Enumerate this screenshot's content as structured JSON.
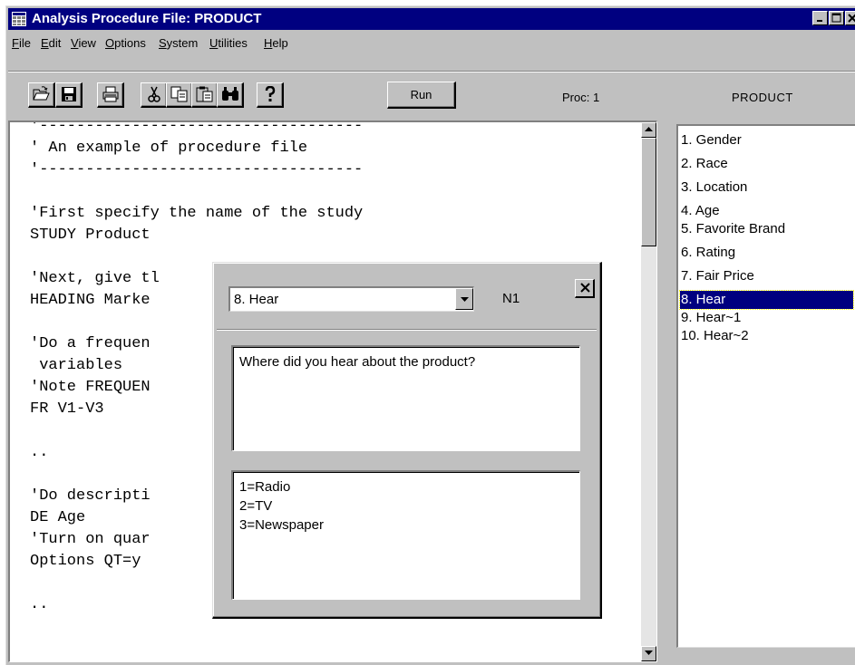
{
  "window": {
    "title": "Analysis Procedure File: PRODUCT"
  },
  "menu": {
    "items": [
      {
        "label": "File",
        "accel": "F"
      },
      {
        "label": "Edit",
        "accel": "E"
      },
      {
        "label": "View",
        "accel": "V"
      },
      {
        "label": "Options",
        "accel": "O"
      },
      {
        "label": "System",
        "accel": "S"
      },
      {
        "label": "Utilities",
        "accel": "U"
      },
      {
        "label": "Help",
        "accel": "H"
      }
    ]
  },
  "toolbar": {
    "buttons": [
      "open-folder-icon",
      "save-icon",
      "print-icon",
      "cut-icon",
      "copy-icon",
      "paste-icon",
      "find-icon",
      "help-icon"
    ],
    "run_label": "Run",
    "proc_label": "Proc: 1",
    "study_name": "PRODUCT"
  },
  "editor": {
    "lines": [
      "'-----------------------------------",
      "' An example of procedure file",
      "'-----------------------------------",
      "",
      "'First specify the name of the study",
      "STUDY Product",
      "",
      "'Next, give tl",
      "HEADING Marke",
      "",
      "'Do a frequen",
      " variables",
      "'Note FREQUEN",
      "FR V1-V3",
      "",
      "..",
      "",
      "'Do descripti",
      "DE Age",
      "'Turn on quar",
      "Options QT=y",
      "",
      ".."
    ]
  },
  "variables": {
    "items": [
      "1. Gender",
      "2. Race",
      "3. Location",
      "4. Age",
      "5. Favorite Brand",
      "6. Rating",
      "7. Fair Price",
      "8. Hear",
      "9. Hear~1",
      "10. Hear~2"
    ],
    "selected_index": 7
  },
  "popup": {
    "selected_variable": "8. Hear",
    "type_label": "N1",
    "question": "Where did you hear about the product?",
    "answers": [
      "1=Radio",
      "2=TV",
      "3=Newspaper"
    ]
  },
  "colors": {
    "titlebar": "#000080",
    "face": "#c0c0c0",
    "selection": "#000080"
  }
}
